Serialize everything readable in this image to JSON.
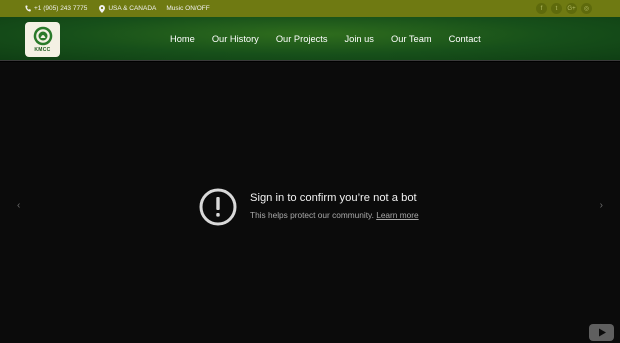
{
  "topbar": {
    "phone": "+1 (905) 243 7775",
    "location": "USA & CANADA",
    "music": "Music ON/OFF",
    "social": [
      {
        "icon": "facebook-icon",
        "glyph": "f"
      },
      {
        "icon": "twitter-icon",
        "glyph": "t"
      },
      {
        "icon": "google-plus-icon",
        "glyph": "G+"
      },
      {
        "icon": "instagram-icon",
        "glyph": "◎"
      }
    ]
  },
  "header": {
    "logo_text": "KMCC",
    "nav": [
      "Home",
      "Our History",
      "Our Projects",
      "Join us",
      "Our Team",
      "Contact"
    ]
  },
  "video": {
    "title": "Sign in to confirm you’re not a bot",
    "subtitle": "This helps protect our community.",
    "link": "Learn more",
    "prev": "‹",
    "next": "›"
  },
  "colors": {
    "topbar": "#6f7a12",
    "header": "#17501a",
    "video_bg": "#0b0b0b"
  }
}
